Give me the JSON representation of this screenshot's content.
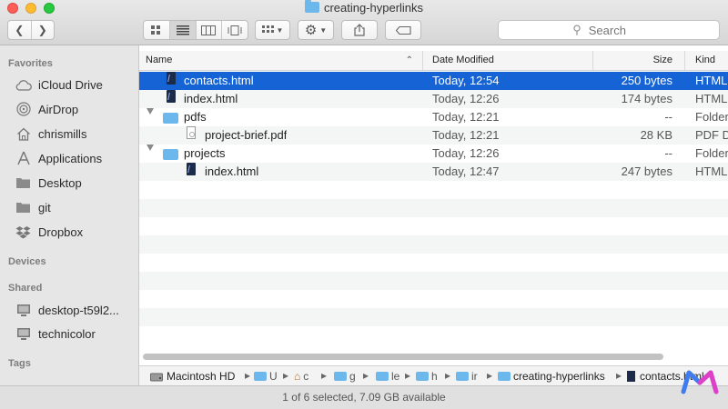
{
  "window": {
    "title": "creating-hyperlinks"
  },
  "toolbar": {
    "search_placeholder": "Search"
  },
  "sidebar": {
    "favorites_header": "Favorites",
    "favorites": [
      {
        "label": "iCloud Drive",
        "icon": "cloud-icon"
      },
      {
        "label": "AirDrop",
        "icon": "airdrop-icon"
      },
      {
        "label": "chrismills",
        "icon": "home-icon"
      },
      {
        "label": "Applications",
        "icon": "applications-icon"
      },
      {
        "label": "Desktop",
        "icon": "desktop-icon"
      },
      {
        "label": "git",
        "icon": "folder-icon"
      },
      {
        "label": "Dropbox",
        "icon": "dropbox-icon"
      }
    ],
    "devices_header": "Devices",
    "shared_header": "Shared",
    "shared": [
      {
        "label": "desktop-t59l2...",
        "icon": "computer-icon"
      },
      {
        "label": "technicolor",
        "icon": "computer-icon"
      }
    ],
    "tags_header": "Tags"
  },
  "columns": {
    "name": "Name",
    "date": "Date Modified",
    "size": "Size",
    "kind": "Kind"
  },
  "files": [
    {
      "name": "contacts.html",
      "date": "Today, 12:54",
      "size": "250 bytes",
      "kind": "HTML",
      "selected": true
    },
    {
      "name": "index.html",
      "date": "Today, 12:26",
      "size": "174 bytes",
      "kind": "HTML"
    },
    {
      "name": "pdfs",
      "date": "Today, 12:21",
      "size": "--",
      "kind": "Folder"
    },
    {
      "name": "project-brief.pdf",
      "date": "Today, 12:21",
      "size": "28 KB",
      "kind": "PDF D"
    },
    {
      "name": "projects",
      "date": "Today, 12:26",
      "size": "--",
      "kind": "Folder"
    },
    {
      "name": "index.html",
      "date": "Today, 12:47",
      "size": "247 bytes",
      "kind": "HTML"
    }
  ],
  "path_bar": {
    "disk": "Macintosh HD",
    "truncated": [
      "U",
      "c",
      "g",
      "le",
      "h",
      "ir"
    ],
    "folder": "creating-hyperlinks",
    "file": "contacts.html"
  },
  "status": {
    "text": "1 of 6 selected, 7.09 GB available"
  }
}
